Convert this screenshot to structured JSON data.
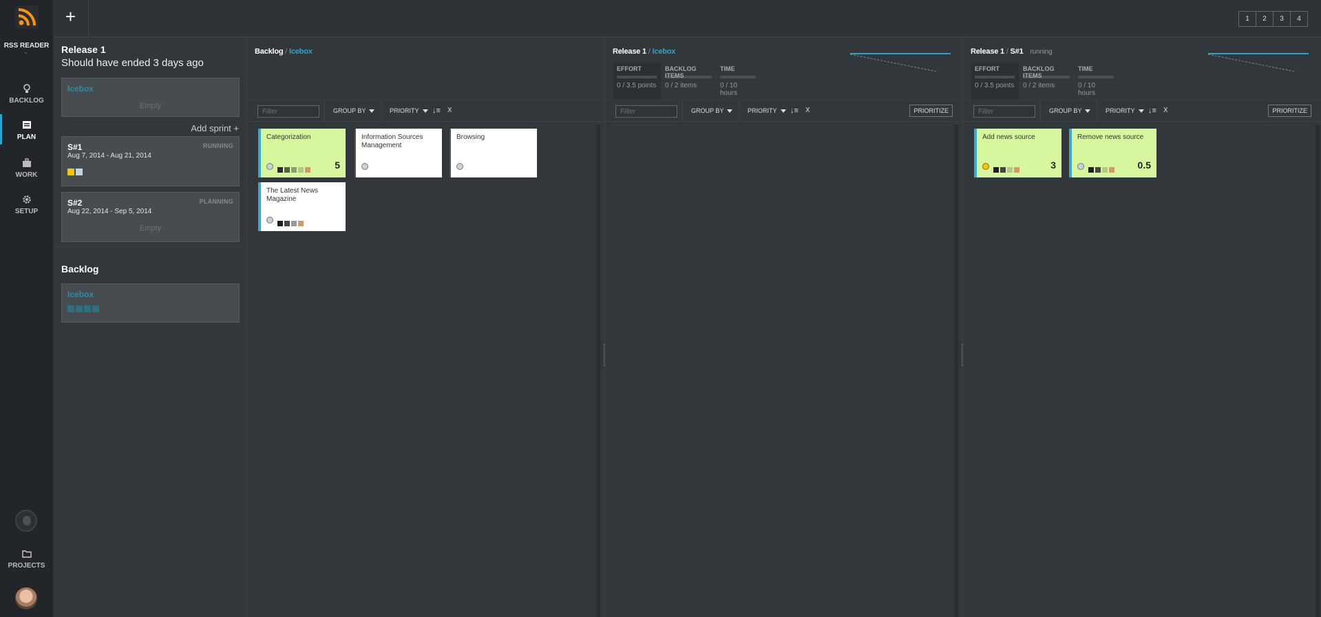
{
  "app": {
    "name": "RSS READER"
  },
  "nav": {
    "items": [
      {
        "label": "BACKLOG"
      },
      {
        "label": "PLAN"
      },
      {
        "label": "WORK"
      },
      {
        "label": "SETUP"
      }
    ],
    "projects_label": "PROJECTS"
  },
  "topbar": {
    "add_label": "+",
    "layouts": [
      "1",
      "2",
      "3",
      "4"
    ]
  },
  "release": {
    "title": "Release 1",
    "subtitle": "Should have ended 3 days ago",
    "icebox": {
      "title": "Icebox",
      "empty": "Empty"
    },
    "add_sprint": "Add sprint +",
    "sprints": [
      {
        "name": "S#1",
        "status": "RUNNING",
        "dates": "Aug 7, 2014 - Aug 21, 2014",
        "chip_colors": [
          "#f2c511",
          "#c8d2dc"
        ]
      },
      {
        "name": "S#2",
        "status": "PLANNING",
        "dates": "Aug 22, 2014 - Sep 5, 2014",
        "empty": "Empty"
      }
    ],
    "backlog_title": "Backlog",
    "backlog_icebox": {
      "title": "Icebox",
      "chip_color": "#2f6f7f"
    }
  },
  "columns": [
    {
      "head": "Backlog",
      "sub": "Icebox",
      "toolbar": {
        "filter_placeholder": "Filter",
        "group_by": "GROUP BY",
        "priority": "PRIORITY",
        "sort": "↓≡",
        "close": "X"
      },
      "cards": [
        {
          "title": "Categorization",
          "color": "green",
          "points": "5",
          "chips": [
            "#2b2b2b",
            "#555e4a",
            "#8ca070",
            "#b2c98a",
            "#d09a6a"
          ]
        },
        {
          "title": "Information Sources Management",
          "color": "white",
          "points": "",
          "chips": []
        },
        {
          "title": "Browsing",
          "color": "white",
          "points": "",
          "chips": []
        },
        {
          "title": "The Latest News Magazine",
          "color": "white",
          "points": "",
          "chips": [
            "#1e1e1e",
            "#444",
            "#999",
            "#d09a6a"
          ]
        }
      ]
    },
    {
      "head": "Release 1",
      "sub": "Icebox",
      "stats": [
        {
          "label": "EFFORT",
          "value": "0 / 3.5 points"
        },
        {
          "label": "BACKLOG ITEMS",
          "value": "0 / 2 items"
        },
        {
          "label": "TIME",
          "value": "0 / 10 hours"
        }
      ],
      "toolbar": {
        "filter_placeholder": "Filter",
        "group_by": "GROUP BY",
        "priority": "PRIORITY",
        "sort": "↓≡",
        "close": "X",
        "prioritize": "PRIORITIZE"
      },
      "cards": []
    },
    {
      "head": "Release 1",
      "sub": "S#1",
      "status": "running",
      "stats": [
        {
          "label": "EFFORT",
          "value": "0 / 3.5 points"
        },
        {
          "label": "BACKLOG ITEMS",
          "value": "0 / 2 items"
        },
        {
          "label": "TIME",
          "value": "0 / 10 hours"
        }
      ],
      "toolbar": {
        "filter_placeholder": "Filter",
        "group_by": "GROUP BY",
        "priority": "PRIORITY",
        "sort": "↓≡",
        "close": "X",
        "prioritize": "PRIORITIZE"
      },
      "cards": [
        {
          "title": "Add news source",
          "color": "green",
          "points": "3",
          "dot": "yellow",
          "chips": [
            "#1e1e1e",
            "#444",
            "#b2c98a",
            "#d09a6a"
          ]
        },
        {
          "title": "Remove news source",
          "color": "green",
          "points": "0.5",
          "chips": [
            "#1e1e1e",
            "#444",
            "#b2c98a",
            "#d09a6a"
          ]
        }
      ]
    }
  ],
  "colors": {
    "accent": "#2ea3c9",
    "card_green": "#d6f79e",
    "panel": "#32373b",
    "nav": "#22262a"
  }
}
